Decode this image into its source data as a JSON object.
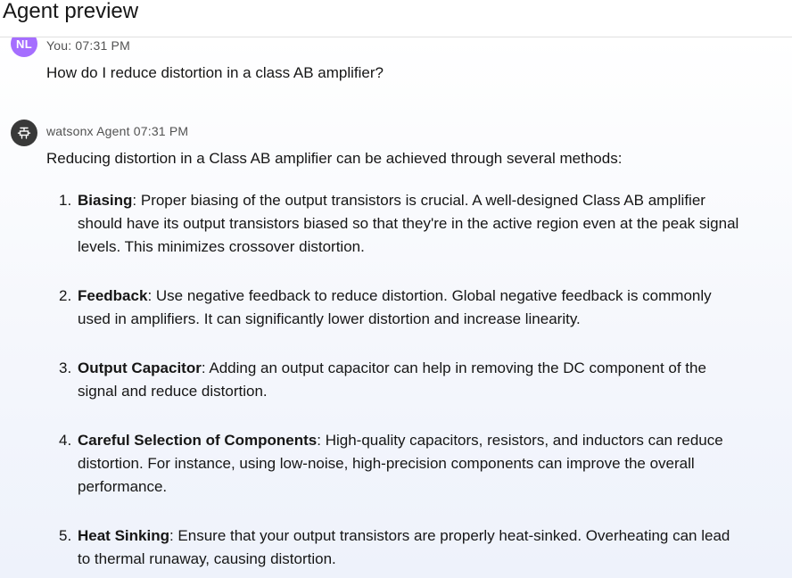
{
  "header": {
    "title": "Agent preview"
  },
  "user_message": {
    "avatar_initials": "NL",
    "meta": "You: 07:31 PM",
    "text": "How do I reduce distortion in a class AB amplifier?"
  },
  "agent_message": {
    "avatar_icon": "agent-robot-icon",
    "meta": "watsonx Agent 07:31 PM",
    "intro": "Reducing distortion in a Class AB amplifier can be achieved through several methods:",
    "steps": [
      {
        "number": "1.",
        "title": "Biasing",
        "text": ": Proper biasing of the output transistors is crucial. A well-designed Class AB amplifier should have its output transistors biased so that they're in the active region even at the peak signal levels. This minimizes crossover distortion."
      },
      {
        "number": "2.",
        "title": "Feedback",
        "text": ": Use negative feedback to reduce distortion. Global negative feedback is commonly used in amplifiers. It can significantly lower distortion and increase linearity."
      },
      {
        "number": "3.",
        "title": "Output Capacitor",
        "text": ": Adding an output capacitor can help in removing the DC component of the signal and reduce distortion."
      },
      {
        "number": "4.",
        "title": "Careful Selection of Components",
        "text": ": High-quality capacitors, resistors, and inductors can reduce distortion. For instance, using low-noise, high-precision components can improve the overall performance."
      },
      {
        "number": "5.",
        "title": "Heat Sinking",
        "text": ": Ensure that your output transistors are properly heat-sinked. Overheating can lead to thermal runaway, causing distortion."
      }
    ]
  },
  "colors": {
    "user_avatar": "#a56eff",
    "agent_avatar": "#393939",
    "meta_text": "#525252",
    "body_text": "#161616"
  }
}
